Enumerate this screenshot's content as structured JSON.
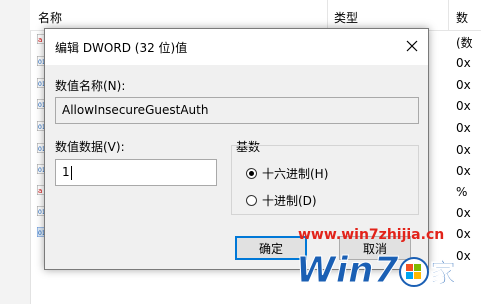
{
  "background": {
    "columns": [
      "名称",
      "类型",
      "数"
    ],
    "value_fragments": [
      "(数",
      "0x",
      "0x",
      "0x",
      "0x",
      "0x",
      "0x",
      "%",
      "0x",
      "0x",
      "0x"
    ]
  },
  "dialog": {
    "title": "编辑 DWORD (32 位)值",
    "name_label": "数值名称(N):",
    "name_value": "AllowInsecureGuestAuth",
    "data_label": "数值数据(V):",
    "data_value": "1",
    "base_label": "基数",
    "base_options": [
      {
        "label": "十六进制(H)",
        "selected": true
      },
      {
        "label": "十进制(D)",
        "selected": false
      }
    ],
    "ok_label": "确定",
    "cancel_label": "取消"
  },
  "watermark": {
    "url": "www.win7zhijia.cn",
    "logo_text": "Win7家",
    "colors": {
      "url": "#e2231a",
      "logo": "#1a5fb4"
    }
  }
}
